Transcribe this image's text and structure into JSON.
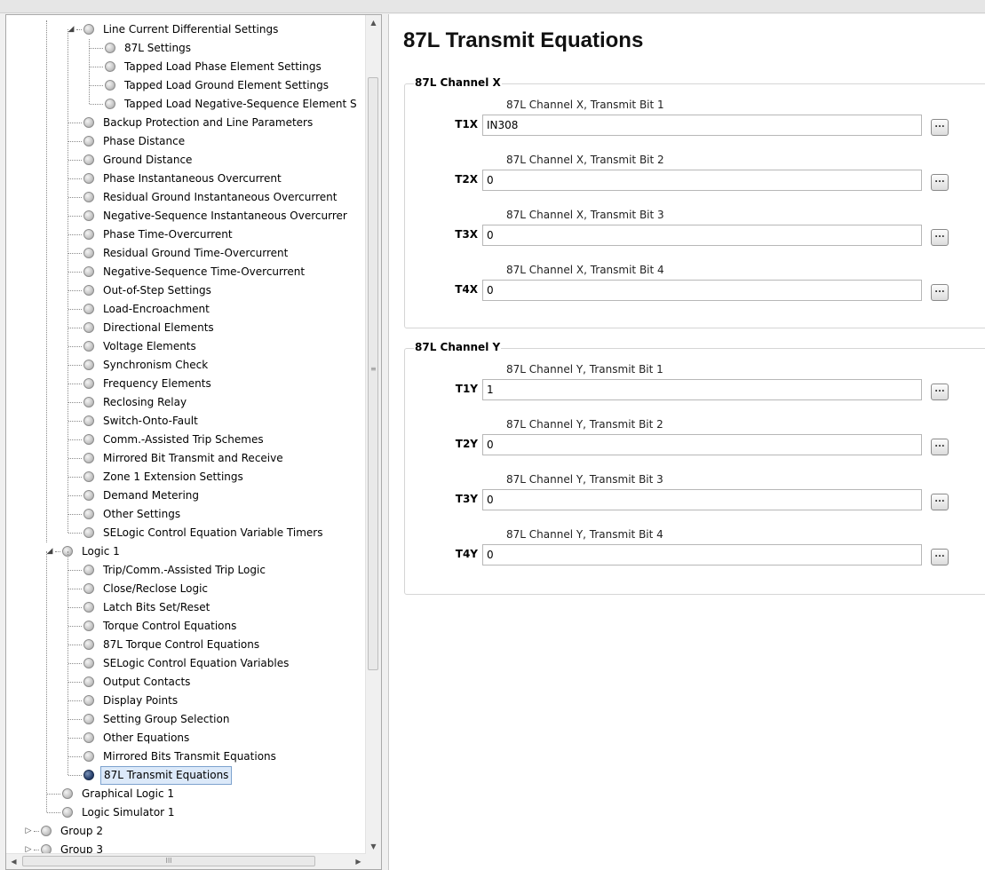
{
  "tree": {
    "items": [
      {
        "label": "Line Current Differential Settings"
      },
      {
        "label": "87L Settings"
      },
      {
        "label": "Tapped Load Phase Element Settings"
      },
      {
        "label": "Tapped Load Ground Element Settings"
      },
      {
        "label": "Tapped Load Negative-Sequence Element S"
      },
      {
        "label": "Backup Protection and Line Parameters"
      },
      {
        "label": "Phase Distance"
      },
      {
        "label": "Ground Distance"
      },
      {
        "label": "Phase Instantaneous Overcurrent"
      },
      {
        "label": "Residual Ground Instantaneous Overcurrent"
      },
      {
        "label": "Negative-Sequence Instantaneous Overcurrer"
      },
      {
        "label": "Phase Time-Overcurrent"
      },
      {
        "label": "Residual Ground Time-Overcurrent"
      },
      {
        "label": "Negative-Sequence Time-Overcurrent"
      },
      {
        "label": "Out-of-Step Settings"
      },
      {
        "label": "Load-Encroachment"
      },
      {
        "label": "Directional Elements"
      },
      {
        "label": "Voltage Elements"
      },
      {
        "label": "Synchronism Check"
      },
      {
        "label": "Frequency Elements"
      },
      {
        "label": "Reclosing Relay"
      },
      {
        "label": "Switch-Onto-Fault"
      },
      {
        "label": "Comm.-Assisted Trip Schemes"
      },
      {
        "label": "Mirrored Bit Transmit and Receive"
      },
      {
        "label": "Zone 1 Extension Settings"
      },
      {
        "label": "Demand Metering"
      },
      {
        "label": "Other Settings"
      },
      {
        "label": "SELogic Control Equation Variable Timers"
      },
      {
        "label": "Logic 1"
      },
      {
        "label": "Trip/Comm.-Assisted Trip Logic"
      },
      {
        "label": "Close/Reclose Logic"
      },
      {
        "label": "Latch Bits Set/Reset"
      },
      {
        "label": "Torque Control Equations"
      },
      {
        "label": "87L Torque Control Equations"
      },
      {
        "label": "SELogic Control Equation Variables"
      },
      {
        "label": "Output Contacts"
      },
      {
        "label": "Display Points"
      },
      {
        "label": "Setting Group Selection"
      },
      {
        "label": "Other Equations"
      },
      {
        "label": "Mirrored Bits Transmit Equations"
      },
      {
        "label": "87L Transmit Equations"
      },
      {
        "label": "Graphical Logic 1"
      },
      {
        "label": "Logic Simulator 1"
      },
      {
        "label": "Group 2"
      },
      {
        "label": "Group 3"
      }
    ],
    "selected": "87L Transmit Equations",
    "hscroll_grip": "III",
    "vscroll_grip": "≡"
  },
  "page": {
    "title": "87L Transmit Equations"
  },
  "groups": [
    {
      "title": "87L Channel X",
      "fields": [
        {
          "caption": "87L Channel X, Transmit Bit 1",
          "name": "T1X",
          "value": "IN308",
          "button": "..."
        },
        {
          "caption": "87L Channel X, Transmit Bit 2",
          "name": "T2X",
          "value": "0",
          "button": "..."
        },
        {
          "caption": "87L Channel X, Transmit Bit 3",
          "name": "T3X",
          "value": "0",
          "button": "..."
        },
        {
          "caption": "87L Channel X, Transmit Bit 4",
          "name": "T4X",
          "value": "0",
          "button": "..."
        }
      ]
    },
    {
      "title": "87L Channel Y",
      "fields": [
        {
          "caption": "87L Channel Y, Transmit Bit 1",
          "name": "T1Y",
          "value": "1",
          "button": "..."
        },
        {
          "caption": "87L Channel Y, Transmit Bit 2",
          "name": "T2Y",
          "value": "0",
          "button": "..."
        },
        {
          "caption": "87L Channel Y, Transmit Bit 3",
          "name": "T3Y",
          "value": "0",
          "button": "..."
        },
        {
          "caption": "87L Channel Y, Transmit Bit 4",
          "name": "T4Y",
          "value": "0",
          "button": "..."
        }
      ]
    }
  ]
}
